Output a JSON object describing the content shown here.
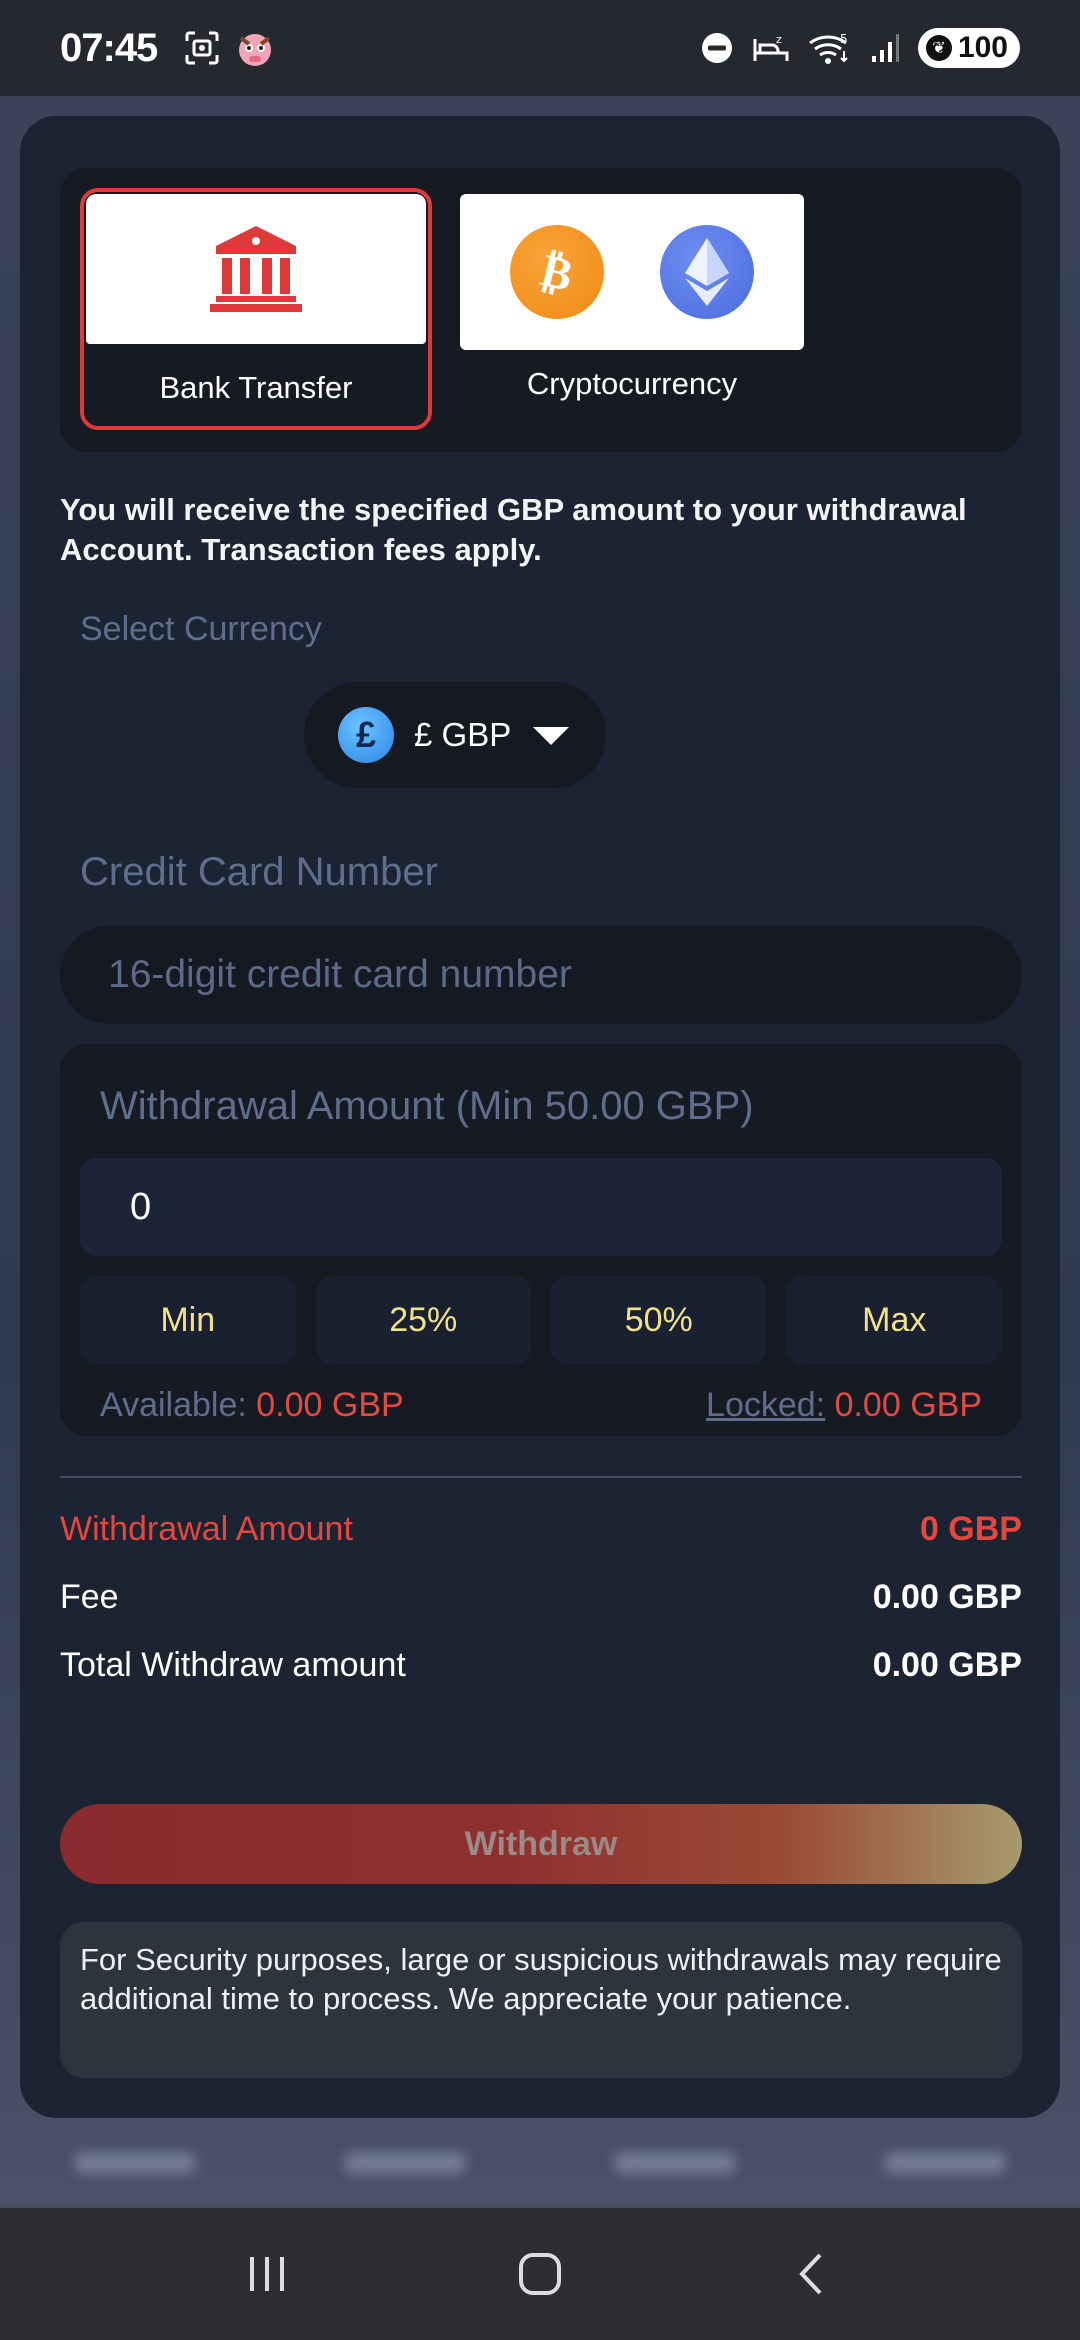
{
  "status_bar": {
    "time": "07:45",
    "battery": "100",
    "icons": [
      "screenshot-icon",
      "app-notification-icon",
      "do-not-disturb-icon",
      "sleep-icon",
      "wifi-icon",
      "signal-icon",
      "battery-saver-icon"
    ]
  },
  "payment_methods": [
    {
      "label": "Bank Transfer",
      "icon": "bank-icon",
      "selected": true
    },
    {
      "label": "Cryptocurrency",
      "icons": [
        "bitcoin-icon",
        "ethereum-icon"
      ],
      "selected": false
    }
  ],
  "info_text": "You will receive the specified GBP amount to your withdrawal Account. Transaction fees apply.",
  "currency": {
    "label": "Select Currency",
    "selected": "£ GBP",
    "symbol": "£"
  },
  "card_number": {
    "label": "Credit Card Number",
    "placeholder": "16-digit credit card number",
    "value": ""
  },
  "amount": {
    "title": "Withdrawal Amount (Min 50.00 GBP)",
    "value": "0",
    "quick_buttons": [
      "Min",
      "25%",
      "50%",
      "Max"
    ],
    "available_label": "Available:",
    "available_value": "0.00 GBP",
    "locked_label": "Locked:",
    "locked_value": "0.00 GBP"
  },
  "summary": {
    "withdrawal_label": "Withdrawal Amount",
    "withdrawal_value": "0 GBP",
    "fee_label": "Fee",
    "fee_value": "0.00 GBP",
    "total_label": "Total Withdraw amount",
    "total_value": "0.00 GBP"
  },
  "withdraw_button": "Withdraw",
  "notice": "For Security purposes, large or suspicious withdrawals may require additional time to process. We appreciate your patience.",
  "colors": {
    "accent_red": "#e24a42",
    "quick_text": "#f3e08a",
    "card_bg": "#1c2333"
  }
}
